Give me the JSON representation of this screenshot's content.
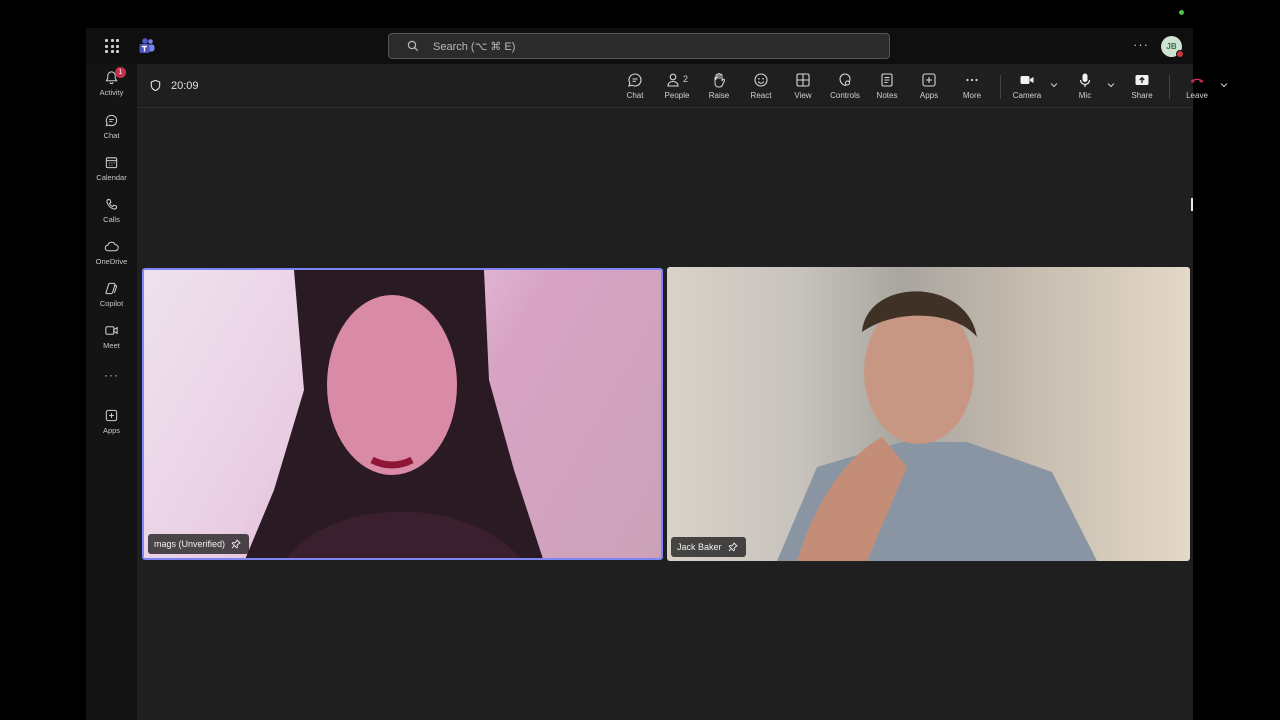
{
  "search": {
    "placeholder": "Search (⌥ ⌘ E)"
  },
  "account": {
    "initials": "JB"
  },
  "rail": {
    "items": [
      {
        "label": "Activity",
        "badge": "1"
      },
      {
        "label": "Chat"
      },
      {
        "label": "Calendar"
      },
      {
        "label": "Calls"
      },
      {
        "label": "OneDrive"
      },
      {
        "label": "Copilot"
      },
      {
        "label": "Meet"
      },
      {
        "label": "Apps"
      }
    ]
  },
  "meeting": {
    "timer": "20:09",
    "toolbar": {
      "chat": "Chat",
      "people": "People",
      "people_count": "2",
      "raise": "Raise",
      "react": "React",
      "view": "View",
      "controls": "Controls",
      "notes": "Notes",
      "apps": "Apps",
      "more": "More",
      "camera": "Camera",
      "mic": "Mic",
      "share": "Share",
      "leave": "Leave"
    },
    "participants": [
      {
        "name": "mags (Unverified)",
        "active_speaker": true
      },
      {
        "name": "Jack Baker",
        "active_speaker": false
      }
    ]
  },
  "colors": {
    "accent": "#7f85f5",
    "leave": "#c4314b",
    "badge": "#c4314b",
    "background": "#1f1f1f"
  }
}
